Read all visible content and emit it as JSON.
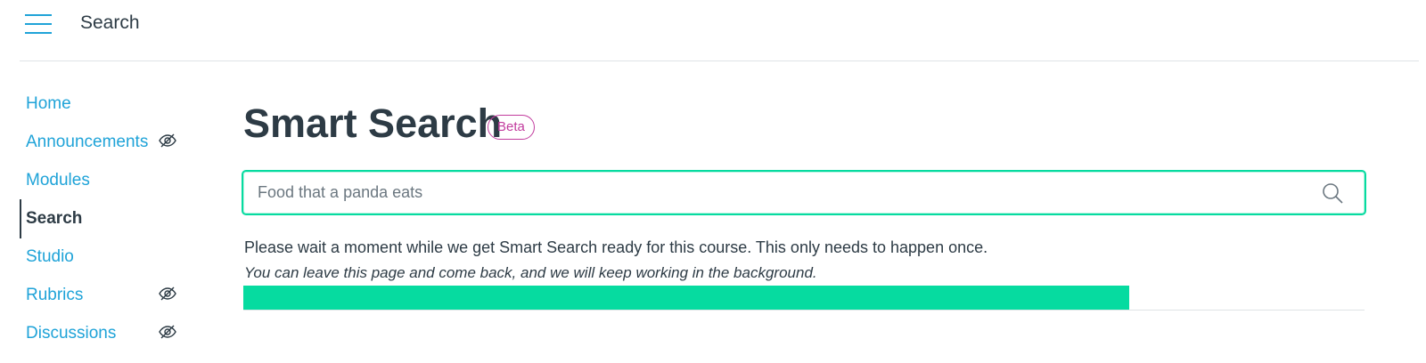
{
  "header": {
    "title": "Search",
    "menu_icon": "hamburger-menu-icon"
  },
  "sidebar": {
    "items": [
      {
        "label": "Home",
        "hidden": false
      },
      {
        "label": "Announcements",
        "hidden": true
      },
      {
        "label": "Modules",
        "hidden": false
      },
      {
        "label": "Search",
        "hidden": false,
        "active": true
      },
      {
        "label": "Studio",
        "hidden": false
      },
      {
        "label": "Rubrics",
        "hidden": true
      },
      {
        "label": "Discussions",
        "hidden": true
      }
    ],
    "hidden_icon": "eye-slash-icon"
  },
  "main": {
    "title": "Smart Search",
    "badge": "Beta",
    "search": {
      "value": "",
      "placeholder": "Food that a panda eats",
      "icon": "search-icon"
    },
    "message_line1": "Please wait a moment while we get Smart Search ready for this course. This only needs to happen once.",
    "message_line2": "You can leave this page and come back, and we will keep working in the background.",
    "progress_percent": 79
  },
  "colors": {
    "link": "#1fa3d8",
    "text": "#2d3b45",
    "accent": "#06dba0",
    "beta": "#c23c9e"
  }
}
